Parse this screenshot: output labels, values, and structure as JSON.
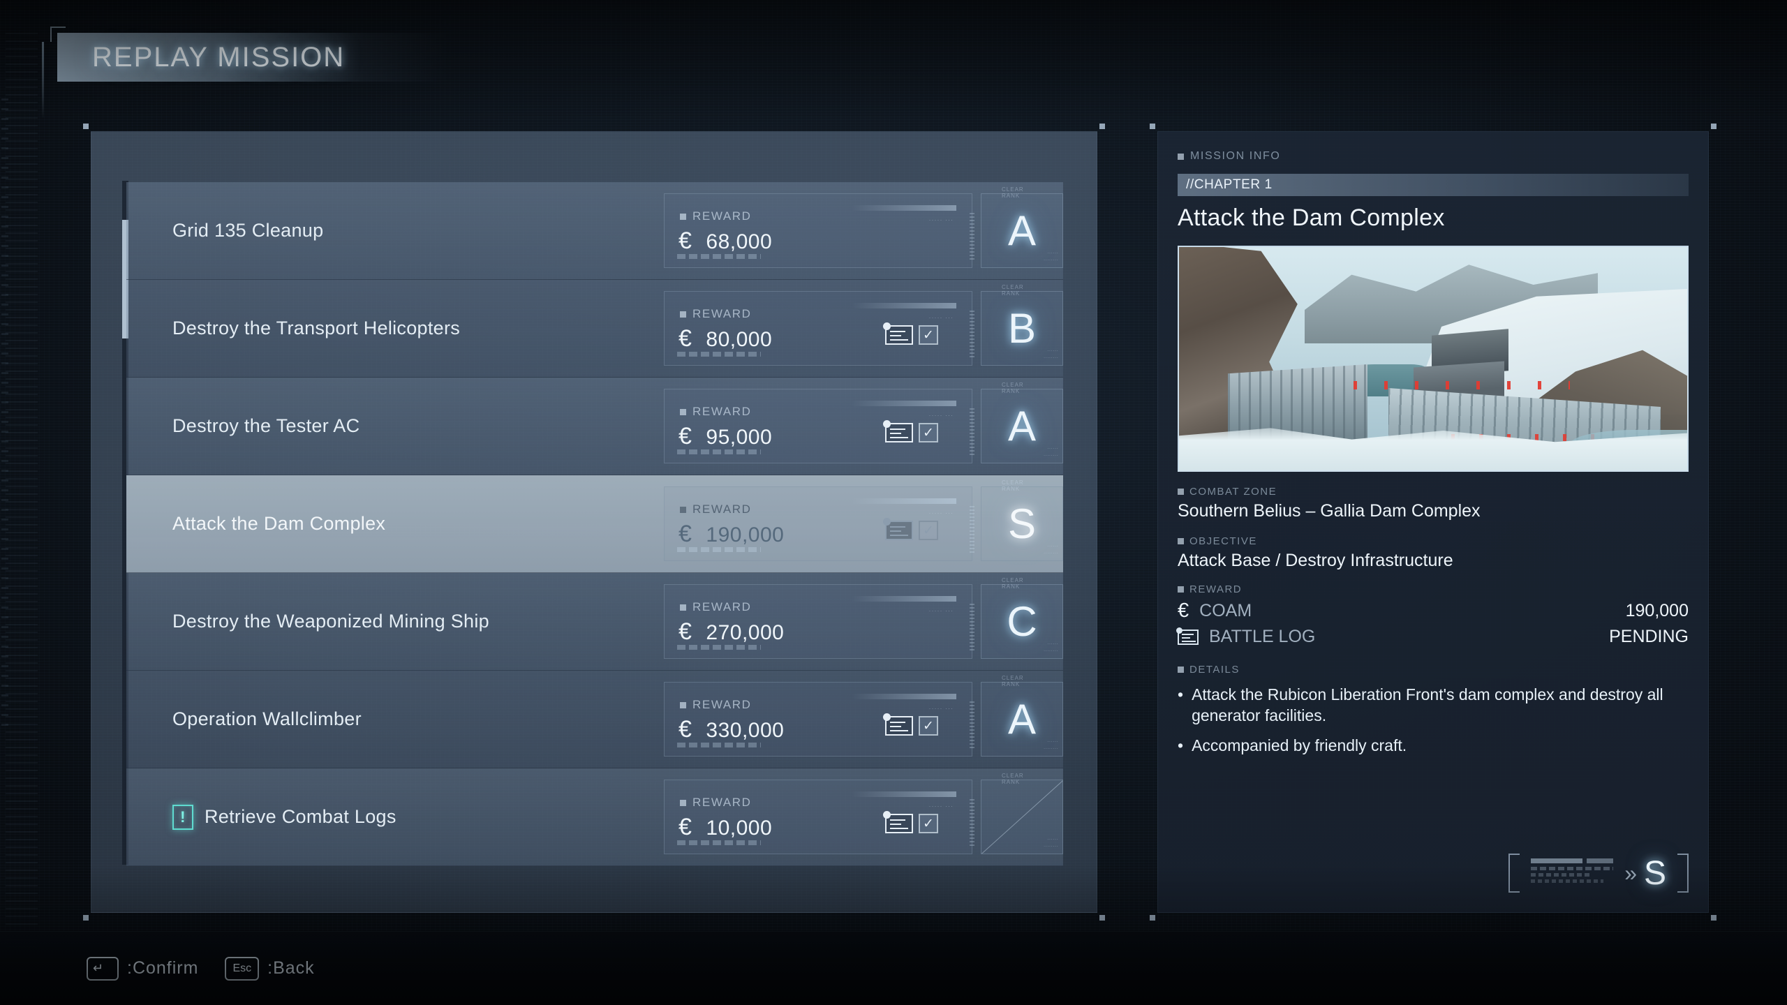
{
  "header": {
    "title": "REPLAY MISSION"
  },
  "missions": [
    {
      "name": "Grid 135 Cleanup",
      "reward_label": "REWARD",
      "reward": "68,000",
      "currency": "€",
      "rank": "A",
      "has_log": false,
      "alert": false,
      "selected": false
    },
    {
      "name": "Destroy the Transport Helicopters",
      "reward_label": "REWARD",
      "reward": "80,000",
      "currency": "€",
      "rank": "B",
      "has_log": true,
      "alert": false,
      "selected": false
    },
    {
      "name": "Destroy the Tester AC",
      "reward_label": "REWARD",
      "reward": "95,000",
      "currency": "€",
      "rank": "A",
      "has_log": true,
      "alert": false,
      "selected": false
    },
    {
      "name": "Attack the Dam Complex",
      "reward_label": "REWARD",
      "reward": "190,000",
      "currency": "€",
      "rank": "S",
      "has_log": true,
      "alert": false,
      "selected": true
    },
    {
      "name": "Destroy the Weaponized Mining Ship",
      "reward_label": "REWARD",
      "reward": "270,000",
      "currency": "€",
      "rank": "C",
      "has_log": false,
      "alert": false,
      "selected": false
    },
    {
      "name": "Operation Wallclimber",
      "reward_label": "REWARD",
      "reward": "330,000",
      "currency": "€",
      "rank": "A",
      "has_log": true,
      "alert": false,
      "selected": false
    },
    {
      "name": "Retrieve Combat Logs",
      "reward_label": "REWARD",
      "reward": "10,000",
      "currency": "€",
      "rank": "",
      "has_log": true,
      "alert": true,
      "selected": false
    }
  ],
  "info": {
    "section_label": "MISSION INFO",
    "chapter": "//CHAPTER 1",
    "title": "Attack the Dam Complex",
    "combat_zone_label": "COMBAT ZONE",
    "combat_zone": "Southern Belius – Gallia Dam Complex",
    "objective_label": "OBJECTIVE",
    "objective": "Attack Base / Destroy Infrastructure",
    "reward_label": "REWARD",
    "coam_label": "COAM",
    "coam_value": "190,000",
    "battle_log_label": "BATTLE LOG",
    "battle_log_value": "PENDING",
    "details_label": "DETAILS",
    "details": [
      "Attack the Rubicon Liberation Front's dam complex and destroy all generator facilities.",
      "Accompanied by friendly craft."
    ],
    "badge_rank": "S",
    "badge_chevrons": "»"
  },
  "footer": {
    "confirm_key": "↵",
    "confirm_label": ":Confirm",
    "back_key": "Esc",
    "back_label": ":Back"
  },
  "colors": {
    "accent_cyan": "#5fdbd0",
    "panel_blue": "#6b8299",
    "text_light": "#eef5fa",
    "bg_dark": "#0e151d"
  }
}
